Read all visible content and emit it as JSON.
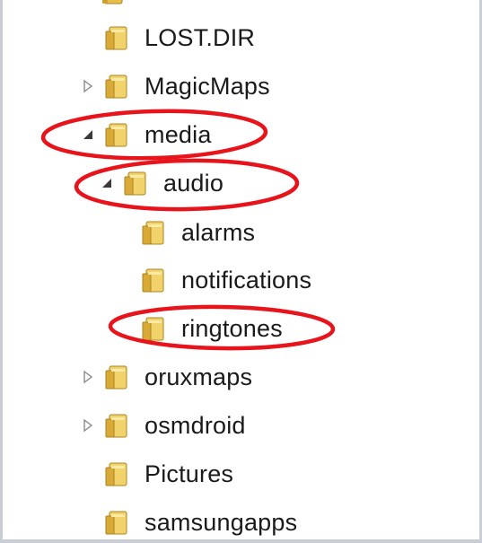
{
  "tree": {
    "items": [
      {
        "label": "LOST.DIR",
        "expander": "none"
      },
      {
        "label": "MagicMaps",
        "expander": "collapsed"
      },
      {
        "label": "media",
        "expander": "expanded"
      },
      {
        "label": "audio",
        "expander": "expanded"
      },
      {
        "label": "alarms",
        "expander": "none"
      },
      {
        "label": "notifications",
        "expander": "none"
      },
      {
        "label": "ringtones",
        "expander": "none"
      },
      {
        "label": "oruxmaps",
        "expander": "collapsed"
      },
      {
        "label": "osmdroid",
        "expander": "collapsed"
      },
      {
        "label": "Pictures",
        "expander": "none"
      },
      {
        "label": "samsungapps",
        "expander": "none"
      }
    ]
  },
  "icons": {
    "folder": "folder-icon",
    "expanded": "expanded-arrow-icon",
    "collapsed": "collapsed-arrow-icon"
  },
  "colors": {
    "annotation_red": "#e8141c",
    "folder_body": "#e6bf4a",
    "folder_dark": "#a98421",
    "text": "#1a1a1a"
  }
}
